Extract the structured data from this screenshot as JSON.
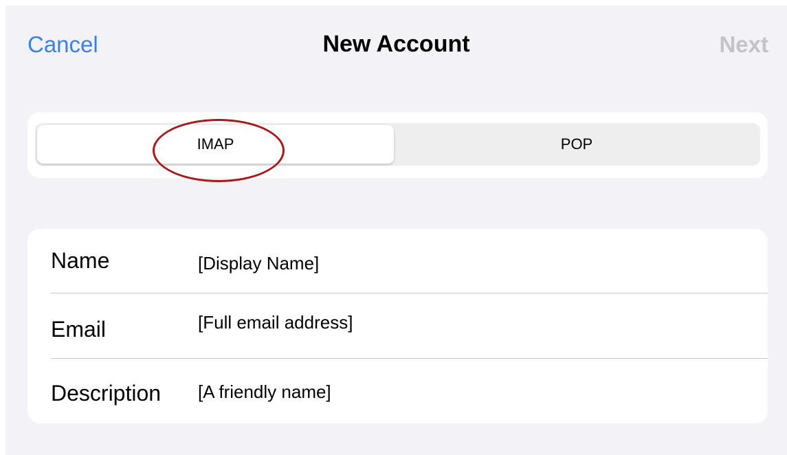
{
  "nav": {
    "cancel_label": "Cancel",
    "title": "New Account",
    "next_label": "Next"
  },
  "segments": {
    "options": [
      "IMAP",
      "POP"
    ],
    "selected": "IMAP"
  },
  "form": {
    "rows": [
      {
        "label": "Name",
        "value": "[Display Name]"
      },
      {
        "label": "Email",
        "value": "[Full email address]"
      },
      {
        "label": "Description",
        "value": "[A friendly name]"
      }
    ]
  },
  "colors": {
    "accent": "#3a82e6",
    "disabled": "#c4c4c7",
    "background": "#f2f2f7",
    "annotation": "#a81919"
  }
}
